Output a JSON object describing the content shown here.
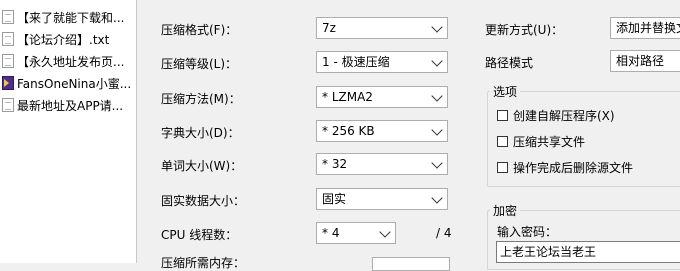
{
  "files": [
    {
      "name": "【来了就能下载和...",
      "icon": "text-file-icon"
    },
    {
      "name": "【论坛介绍】.txt",
      "icon": "text-file-icon"
    },
    {
      "name": "【永久地址发布页...",
      "icon": "text-file-icon"
    },
    {
      "name": "FansOneNina小蜜...",
      "icon": "media-file-icon"
    },
    {
      "name": "最新地址及APP请...",
      "icon": "text-file-icon"
    }
  ],
  "settings": {
    "format_label": "压缩格式(F)：",
    "format_value": "7z",
    "level_label": "压缩等级(L)：",
    "level_value": "1 - 极速压缩",
    "method_label": "压缩方法(M)：",
    "method_value": "* LZMA2",
    "dict_label": "字典大小(D)：",
    "dict_value": "* 256 KB",
    "word_label": "单词大小(W)：",
    "word_value": "* 32",
    "solid_label": "固实数据大小：",
    "solid_value": "固实",
    "cpu_label": "CPU 线程数：",
    "cpu_value": "* 4",
    "cpu_max": "/ 4",
    "memory_label": "压缩所需内存："
  },
  "update": {
    "mode_label": "更新方式(U)：",
    "mode_value": "添加并替换文件",
    "path_label": "路径模式",
    "path_value": "相对路径"
  },
  "options": {
    "title": "选项",
    "sfx_label": "创建自解压程序(X)",
    "shared_label": "压缩共享文件",
    "delete_label": "操作完成后删除源文件"
  },
  "encryption": {
    "title": "加密",
    "password_label": "输入密码：",
    "password_value": "上老王论坛当老王"
  }
}
